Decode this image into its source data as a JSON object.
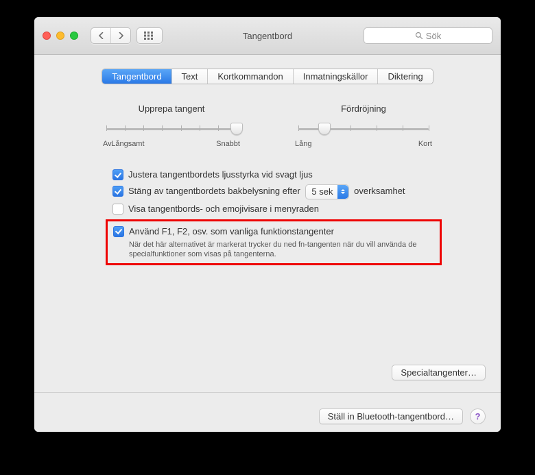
{
  "window": {
    "title": "Tangentbord",
    "search_placeholder": "Sök"
  },
  "tabs": [
    {
      "label": "Tangentbord",
      "active": true
    },
    {
      "label": "Text",
      "active": false
    },
    {
      "label": "Kortkommandon",
      "active": false
    },
    {
      "label": "Inmatningskällor",
      "active": false
    },
    {
      "label": "Diktering",
      "active": false
    }
  ],
  "sliders": {
    "repeat": {
      "label": "Upprepa tangent",
      "left": "Av",
      "mid": "Långsamt",
      "right": "Snabbt",
      "ticks": 8,
      "value_index": 7
    },
    "delay": {
      "label": "Fördröjning",
      "left": "Lång",
      "right": "Kort",
      "ticks": 6,
      "value_index": 1
    }
  },
  "options": {
    "adjust_brightness": {
      "checked": true,
      "label": "Justera tangentbordets ljusstyrka vid svagt ljus"
    },
    "backlight_off": {
      "checked": true,
      "label_before": "Stäng av tangentbordets bakbelysning efter",
      "select_value": "5 sek",
      "label_after": "overksamhet"
    },
    "emoji_viewer": {
      "checked": false,
      "label": "Visa tangentbords- och emojivisare i menyraden"
    },
    "fn_keys": {
      "checked": true,
      "label": "Använd F1, F2, osv. som vanliga funktionstangenter",
      "sub": "När det här alternativet är markerat trycker du ned fn-tangenten när du vill använda de specialfunktioner som visas på tangenterna."
    }
  },
  "buttons": {
    "modifier": "Specialtangenter…",
    "bluetooth": "Ställ in Bluetooth-tangentbord…",
    "help": "?"
  }
}
